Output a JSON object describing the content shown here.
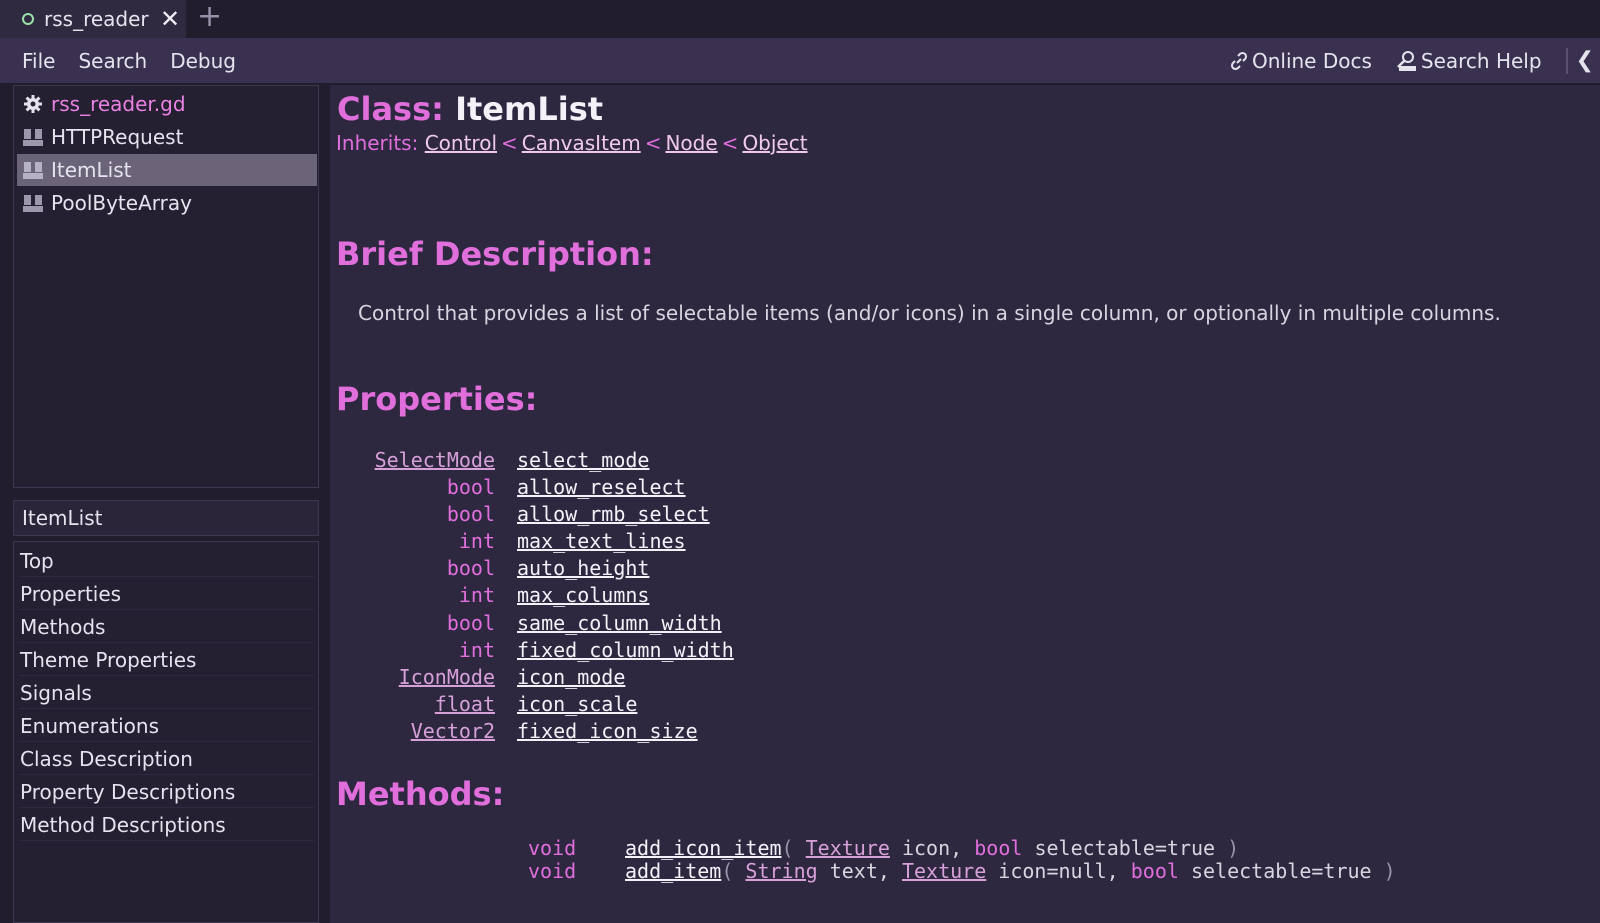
{
  "tab": {
    "title": "rss_reader",
    "close": "✕",
    "add": "+"
  },
  "menu": {
    "file": "File",
    "search": "Search",
    "debug": "Debug",
    "online_docs": "Online Docs",
    "search_help": "Search Help"
  },
  "scripts": [
    {
      "label": "rss_reader.gd",
      "icon": "gear-icon"
    },
    {
      "label": "HTTPRequest",
      "icon": "doc-icon"
    },
    {
      "label": "ItemList",
      "icon": "doc-icon",
      "active": true
    },
    {
      "label": "PoolByteArray",
      "icon": "doc-icon"
    }
  ],
  "filter": {
    "value": "ItemList"
  },
  "sections": [
    "Top",
    "Properties",
    "Methods",
    "Theme Properties",
    "Signals",
    "Enumerations",
    "Class Description",
    "Property Descriptions",
    "Method Descriptions"
  ],
  "doc": {
    "class_label": "Class:",
    "class_name": "ItemList",
    "inherits_label": "Inherits:",
    "inherits": [
      "Control",
      "CanvasItem",
      "Node",
      "Object"
    ],
    "lt": "<",
    "brief_heading": "Brief Description:",
    "brief_text": "Control that provides a list of selectable items (and/or icons) in a single column, or optionally in multiple columns.",
    "properties_heading": "Properties:",
    "properties": [
      {
        "type": "SelectMode",
        "name": "select_mode",
        "link": true
      },
      {
        "type": "bool",
        "name": "allow_reselect",
        "link": false
      },
      {
        "type": "bool",
        "name": "allow_rmb_select",
        "link": false
      },
      {
        "type": "int",
        "name": "max_text_lines",
        "link": false
      },
      {
        "type": "bool",
        "name": "auto_height",
        "link": false
      },
      {
        "type": "int",
        "name": "max_columns",
        "link": false
      },
      {
        "type": "bool",
        "name": "same_column_width",
        "link": false
      },
      {
        "type": "int",
        "name": "fixed_column_width",
        "link": false
      },
      {
        "type": "IconMode",
        "name": "icon_mode",
        "link": true
      },
      {
        "type": "float",
        "name": "icon_scale",
        "link": true
      },
      {
        "type": "Vector2",
        "name": "fixed_icon_size",
        "link": true
      }
    ],
    "methods_heading": "Methods:",
    "methods": [
      {
        "ret": "void",
        "name": "add_icon_item",
        "open": "(",
        "close": ")",
        "p1_type": "Texture",
        "p1_rest": " icon, ",
        "p2_type": "bool",
        "p2_rest": " selectable=true ",
        "p3_type": "",
        "p3_rest": ""
      },
      {
        "ret": "void",
        "name": "add_item",
        "open": "(",
        "close": ")",
        "p1_type": "String",
        "p1_rest": " text, ",
        "p2_type": "Texture",
        "p2_rest": " icon=null, ",
        "p3_type": "bool",
        "p3_rest": " selectable=true "
      }
    ]
  }
}
